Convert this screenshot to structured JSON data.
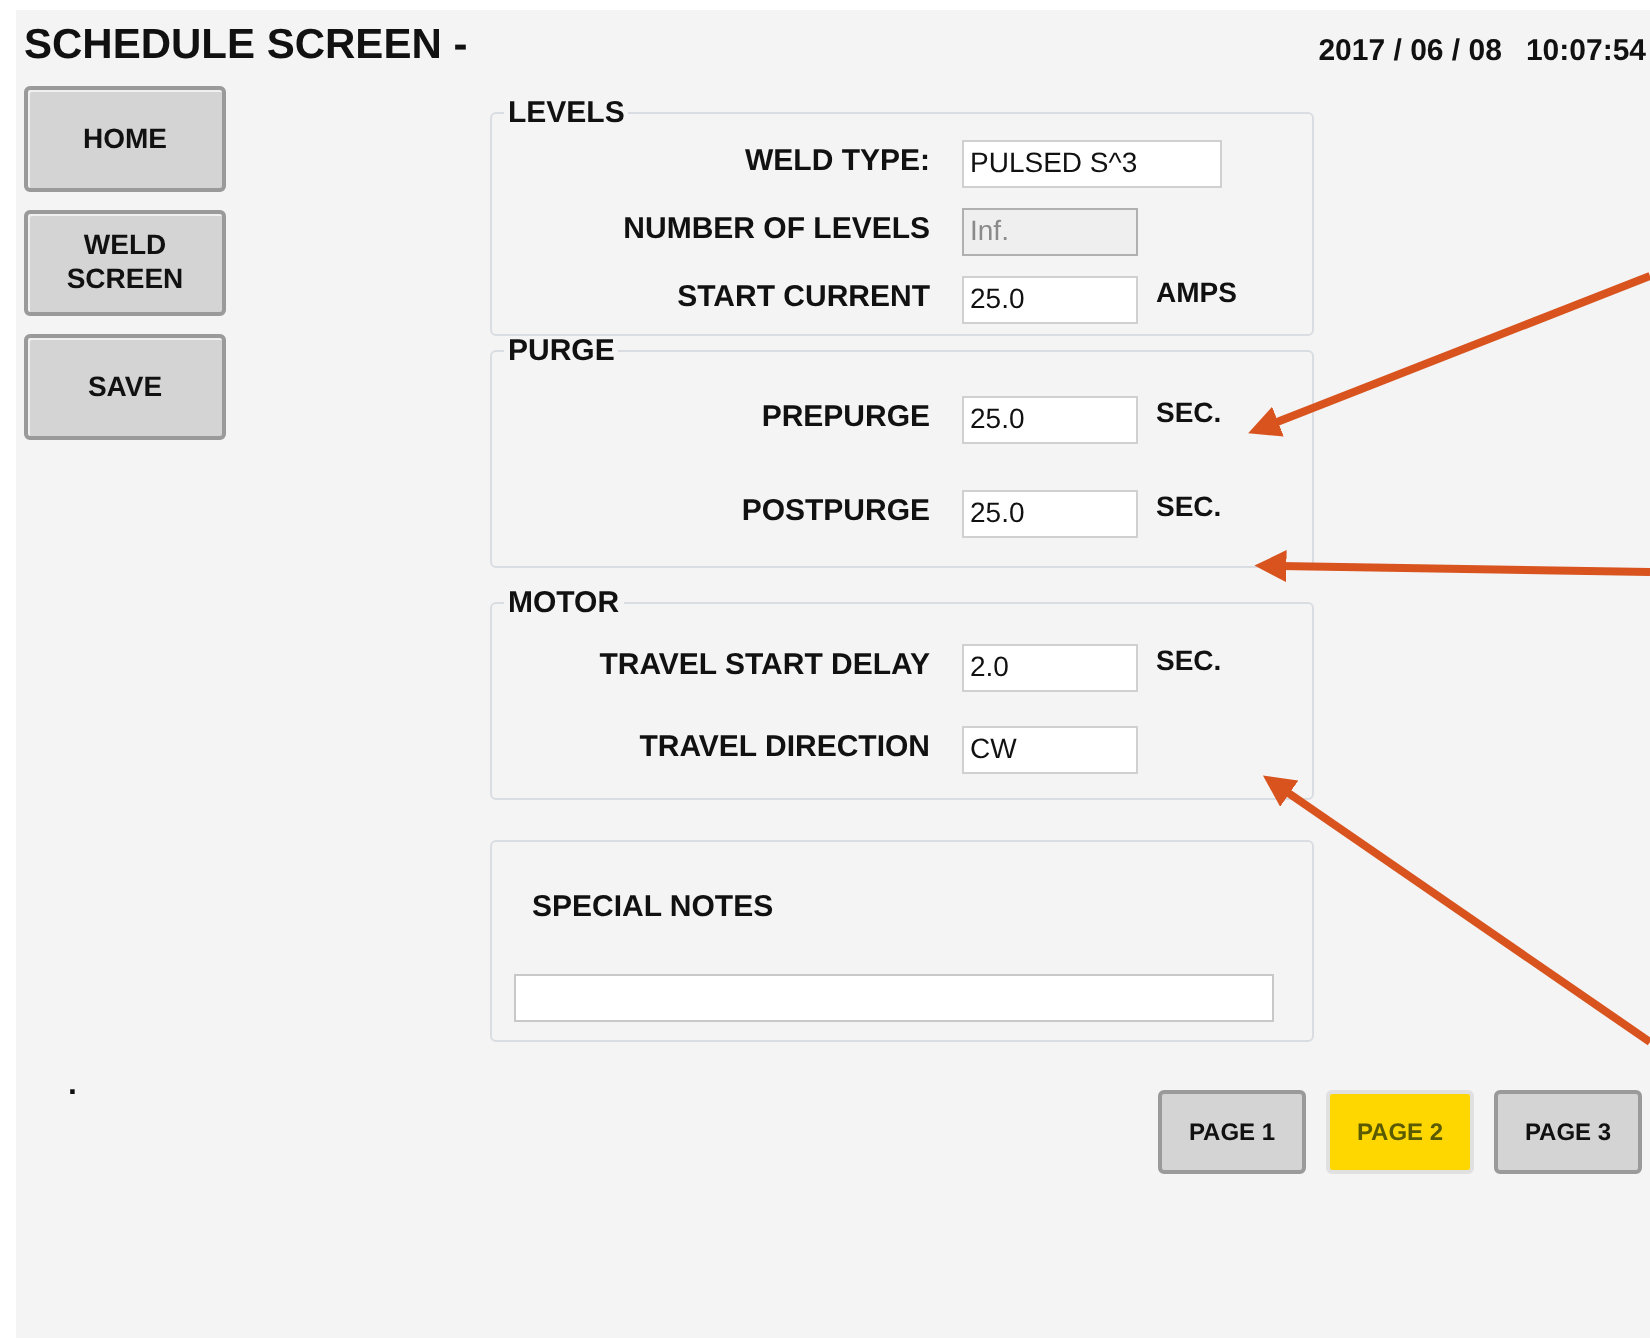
{
  "title": "SCHEDULE SCREEN -",
  "datetime": {
    "date": "2017 / 06 / 08",
    "time": "10:07:54"
  },
  "nav_buttons": [
    {
      "label": "HOME"
    },
    {
      "label": "WELD SCREEN"
    },
    {
      "label": "SAVE"
    }
  ],
  "sections": [
    {
      "title": "LEVELS",
      "fields": [
        {
          "label": "WELD TYPE:",
          "value": "PULSED S^3",
          "kind": "text",
          "disabled": false
        },
        {
          "label": "NUMBER OF LEVELS",
          "value": "Inf.",
          "kind": "number",
          "disabled": true
        },
        {
          "label": "START CURRENT",
          "value": "25.0",
          "unit": "AMPS",
          "kind": "number",
          "disabled": false
        }
      ]
    },
    {
      "title": "PURGE",
      "fields": [
        {
          "label": "PREPURGE",
          "value": "25.0",
          "unit": "SEC.",
          "kind": "number",
          "disabled": false
        },
        {
          "label": "POSTPURGE",
          "value": "25.0",
          "unit": "SEC.",
          "kind": "number",
          "disabled": false
        }
      ]
    },
    {
      "title": "MOTOR",
      "fields": [
        {
          "label": "TRAVEL START DELAY",
          "value": "2.0",
          "unit": "SEC.",
          "kind": "number",
          "disabled": false
        },
        {
          "label": "TRAVEL DIRECTION",
          "value": "CW",
          "kind": "number",
          "disabled": false
        }
      ]
    }
  ],
  "special_notes": {
    "label": "SPECIAL NOTES"
  },
  "dot": ".",
  "pages": [
    {
      "label": "PAGE 1",
      "selected": false
    },
    {
      "label": "PAGE 2",
      "selected": true
    },
    {
      "label": "PAGE 3",
      "selected": false
    }
  ]
}
